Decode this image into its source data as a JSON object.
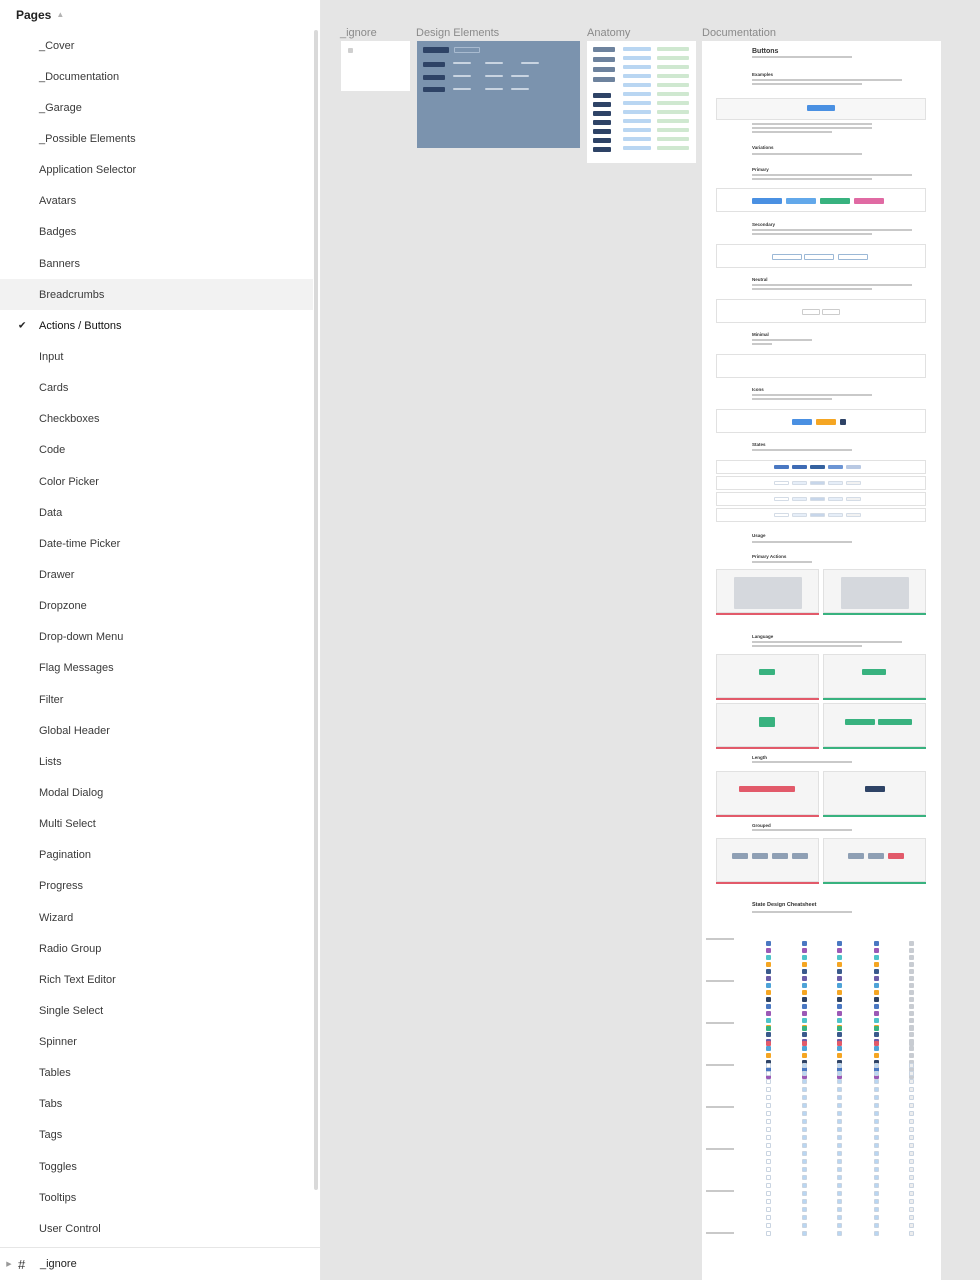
{
  "sidebar": {
    "title": "Pages",
    "pages": [
      {
        "label": "_Cover"
      },
      {
        "label": "_Documentation"
      },
      {
        "label": "_Garage"
      },
      {
        "label": "_Possible Elements"
      },
      {
        "label": "Application Selector"
      },
      {
        "label": "Avatars"
      },
      {
        "label": "Badges"
      },
      {
        "label": "Banners"
      },
      {
        "label": "Breadcrumbs",
        "hover": true
      },
      {
        "label": "Actions / Buttons",
        "current": true
      },
      {
        "label": "Input"
      },
      {
        "label": "Cards"
      },
      {
        "label": "Checkboxes"
      },
      {
        "label": "Code"
      },
      {
        "label": "Color Picker"
      },
      {
        "label": "Data"
      },
      {
        "label": "Date-time Picker"
      },
      {
        "label": "Drawer"
      },
      {
        "label": "Dropzone"
      },
      {
        "label": "Drop-down Menu"
      },
      {
        "label": "Flag Messages"
      },
      {
        "label": "Filter"
      },
      {
        "label": "Global Header"
      },
      {
        "label": "Lists"
      },
      {
        "label": "Modal Dialog"
      },
      {
        "label": "Multi Select"
      },
      {
        "label": "Pagination"
      },
      {
        "label": "Progress"
      },
      {
        "label": "Wizard"
      },
      {
        "label": "Radio Group"
      },
      {
        "label": "Rich Text Editor"
      },
      {
        "label": "Single Select"
      },
      {
        "label": "Spinner"
      },
      {
        "label": "Tables"
      },
      {
        "label": "Tabs"
      },
      {
        "label": "Tags"
      },
      {
        "label": "Toggles"
      },
      {
        "label": "Tooltips"
      },
      {
        "label": "User Control"
      }
    ],
    "footer_layer": "_ignore"
  },
  "canvas": {
    "frames": [
      {
        "label": "_ignore"
      },
      {
        "label": "Design Elements"
      },
      {
        "label": "Anatomy"
      },
      {
        "label": "Documentation"
      }
    ],
    "doc": {
      "title": "Buttons",
      "sections": [
        "Examples",
        "Variations",
        "Primary",
        "Secondary",
        "Neutral",
        "Minimal",
        "Icons",
        "States",
        "Usage",
        "Primary Actions",
        "Language",
        "Length",
        "Grouped",
        "State Design Cheatsheet"
      ]
    }
  },
  "colors": {
    "accent_blue": "#4a90e2",
    "design_frame_bg": "#7b93ae",
    "dark_button": "#2e4366",
    "danger_red": "#e25a6a",
    "success_green": "#38b27f",
    "purple": "#9b59b6",
    "orange": "#f5a623",
    "teal": "#4ec3c9"
  },
  "icons": {
    "collapse": "chevron-up-icon",
    "current_check": "check-icon",
    "layer_frame": "hash-frame-icon",
    "expand": "caret-right-icon"
  }
}
